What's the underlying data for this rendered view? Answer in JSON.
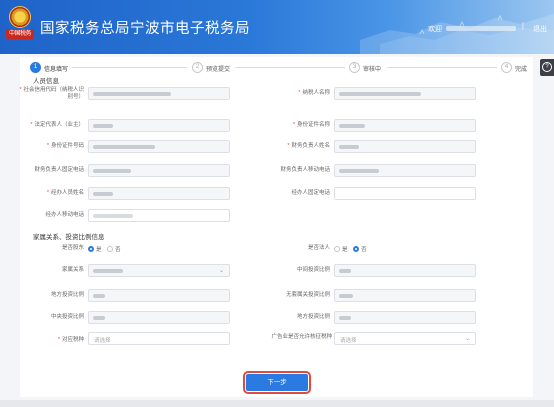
{
  "header": {
    "title": "国家税务总局宁波市电子税务局",
    "logo_text": "中国税务",
    "user_label": "欢迎",
    "separator": "|",
    "logout": "退出"
  },
  "steps": [
    {
      "num": "1",
      "label": "信息填写",
      "state": "active"
    },
    {
      "num": "2",
      "label": "预览提交",
      "state": "idle"
    },
    {
      "num": "3",
      "label": "审核中",
      "state": "idle"
    },
    {
      "num": "4",
      "label": "完成",
      "state": "idle"
    }
  ],
  "help_icon": "question-icon",
  "sections": {
    "basic": "人员信息",
    "family": "家属关系、投资比例信息"
  },
  "fields": {
    "credit_code": "社会信用代码（纳税人识别号）",
    "taxpayer_name": "纳税人名称",
    "legal_rep": "法定代表人（业主）",
    "id_type": "身份证件名称",
    "id_number": "身份证件号码",
    "fin_name": "财务负责人姓名",
    "fin_phone": "财务负责人固定电话",
    "fin_mobile": "财务负责人移动电话",
    "agent_name": "经办人员姓名",
    "agent_phone": "经办人固定电话",
    "agent_mobile": "经办人移动电话",
    "is_shareholder": "是否股东",
    "is_legal": "是否法人",
    "family_relation": "家属关系",
    "middle_ratio": "中间投资比例",
    "local_ratio": "地方投资比例",
    "nonlocal_ratio": "无套属关投资比例",
    "central_ratio": "中央投资比例",
    "local_holding": "地方投资比例",
    "tax_link": "对应税种",
    "industry_tax": "广告业是否允许核征税种"
  },
  "radios": {
    "yes": "是",
    "no": "否"
  },
  "placeholders": {
    "select": "请选择"
  },
  "next_button": "下一步"
}
